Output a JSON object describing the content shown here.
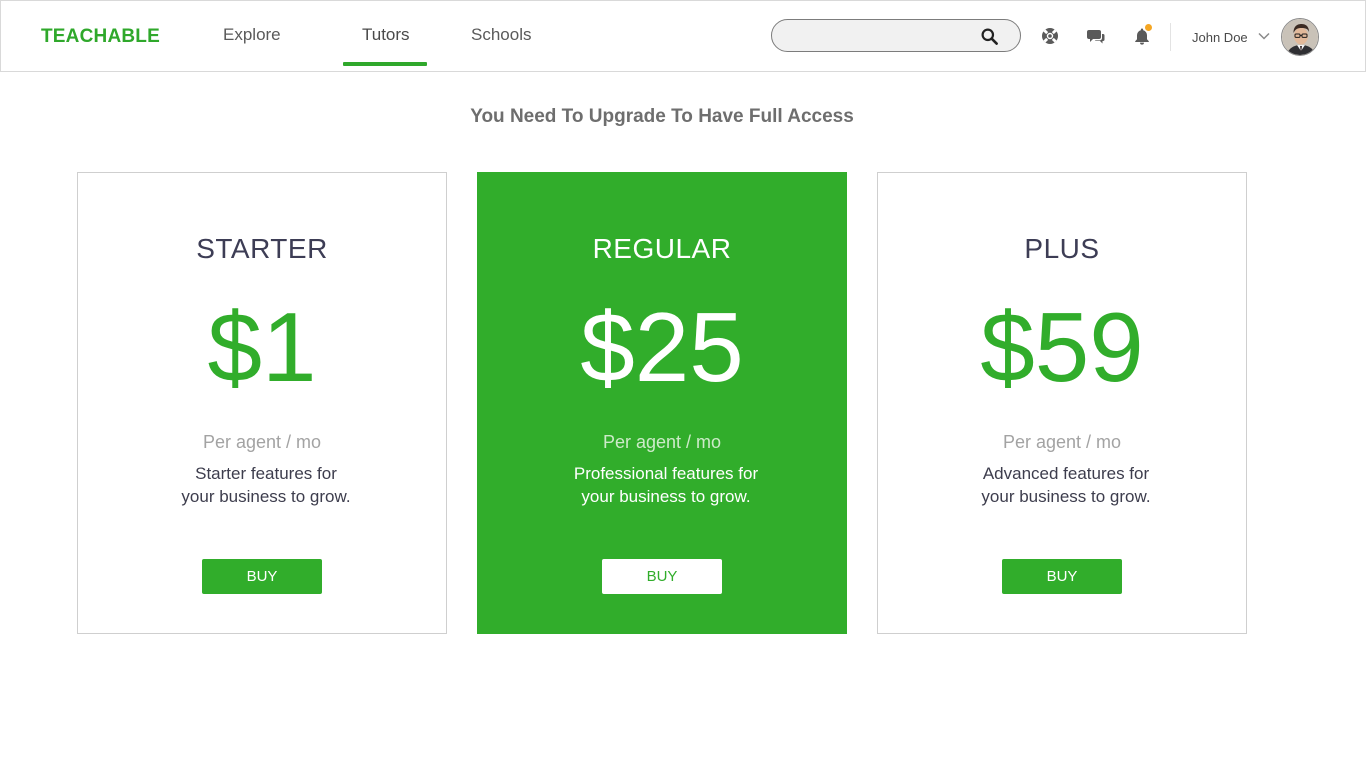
{
  "brand": "TEACHABLE",
  "nav": {
    "explore": "Explore",
    "tutors": "Tutors",
    "schools": "Schools",
    "active": "Tutors"
  },
  "search": {
    "value": "",
    "placeholder": ""
  },
  "header": {
    "icons": [
      "search-icon",
      "help-icon",
      "chat-icon",
      "bell-icon",
      "chevron-down-icon"
    ],
    "notification_dot_color": "#f5a623"
  },
  "user": {
    "name": "John Doe"
  },
  "main": {
    "title": "You Need To Upgrade To Have Full Access"
  },
  "plans": [
    {
      "name": "STARTER",
      "price": "$1",
      "period": "Per agent / mo",
      "desc_line1": "Starter features for",
      "desc_line2": "your business to grow.",
      "button": "BUY"
    },
    {
      "name": "REGULAR",
      "price": "$25",
      "period": "Per agent / mo",
      "desc_line1": "Professional features for",
      "desc_line2": "your business to grow.",
      "button": "BUY"
    },
    {
      "name": "PLUS",
      "price": "$59",
      "period": "Per agent / mo",
      "desc_line1": "Advanced features for",
      "desc_line2": "your business to grow.",
      "button": "BUY"
    }
  ],
  "colors": {
    "accent": "#31ad2b",
    "brand": "#2fa82b",
    "text": "#3d3d55",
    "muted": "#a3a3a3"
  }
}
